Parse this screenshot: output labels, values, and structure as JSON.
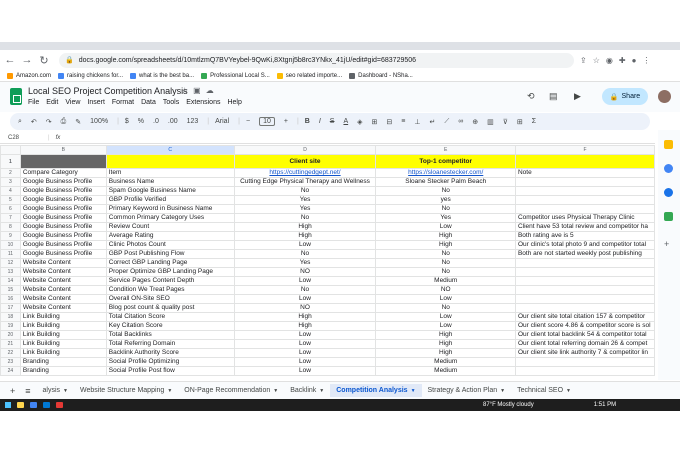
{
  "browser": {
    "url": "docs.google.com/spreadsheets/d/10mtlzmQ7BVYeybel-9QwKi,8Xtgnj5b8rc3YNkx_41jU/edit#gid=683729506",
    "bookmarks": [
      {
        "label": "Amazon.com",
        "color": "#ff9900"
      },
      {
        "label": "raising chickens for...",
        "color": "#4285f4"
      },
      {
        "label": "what is the best ba...",
        "color": "#4285f4"
      },
      {
        "label": "Professional Local S...",
        "color": "#34a853"
      },
      {
        "label": "seo related importe...",
        "color": "#fbbc04"
      },
      {
        "label": "Dashboard - NSha...",
        "color": "#5f6368"
      }
    ]
  },
  "sheets": {
    "title": "Local SEO Project  Competition Analysis",
    "menu": [
      "File",
      "Edit",
      "View",
      "Insert",
      "Format",
      "Data",
      "Tools",
      "Extensions",
      "Help"
    ],
    "share_label": "Share",
    "toolbar": {
      "zoom": "100%",
      "currency": "$",
      "percent": "%",
      "dec_less": ".0",
      "dec_more": ".00",
      "number_fmt": "123",
      "font": "Arial",
      "font_size": "10"
    },
    "cell_ref": "C28",
    "fx": "fx"
  },
  "grid": {
    "columns": [
      "B",
      "C",
      "D",
      "E",
      "F"
    ],
    "header_row": {
      "client": "Client site",
      "competitor": "Top-1 competitor"
    },
    "row2": {
      "a": "Compare Category",
      "b": "Item",
      "c": "https://cuttingedgept.net/",
      "d": "https://sloanestecker.com/",
      "e": "Note"
    },
    "rows": [
      [
        "3",
        "Google Business Profile",
        "Business Name",
        "Cutting Edge Physical Therapy and Wellness",
        "Sloane Stecker Palm Beach",
        ""
      ],
      [
        "4",
        "Google Business Profile",
        "Spam Google Business Name",
        "No",
        "No",
        ""
      ],
      [
        "5",
        "Google Business Profile",
        "GBP Profile Verified",
        "Yes",
        "yes",
        ""
      ],
      [
        "6",
        "Google Business Profile",
        "Primary Keyword in Business Name",
        "Yes",
        "No",
        ""
      ],
      [
        "7",
        "Google Business Profile",
        "Common Primary Category Uses",
        "No",
        "Yes",
        "Competitor uses Physical Therapy Clinic"
      ],
      [
        "8",
        "Google Business Profile",
        "Review Count",
        "High",
        "Low",
        "Client have 53 total review and competitor ha"
      ],
      [
        "9",
        "Google Business Profile",
        "Average Rating",
        "High",
        "High",
        "Both rating ave is 5"
      ],
      [
        "10",
        "Google Business Profile",
        "Clinic Photos Count",
        "Low",
        "High",
        "Our clinic's total photo 9 and competitor total"
      ],
      [
        "11",
        "Google Business Profile",
        "GBP Post Publishing Flow",
        "No",
        "No",
        "Both are not started weekly post publishing"
      ],
      [
        "12",
        "Website Content",
        "Correct GBP Landing Page",
        "Yes",
        "No",
        ""
      ],
      [
        "13",
        "Website Content",
        "Proper Optimize GBP Landing Page",
        "NO",
        "No",
        ""
      ],
      [
        "14",
        "Website Content",
        "Service Pages Content Depth",
        "Low",
        "Medium",
        ""
      ],
      [
        "15",
        "Website Content",
        "Condition We Treat Pages",
        "No",
        "NO",
        ""
      ],
      [
        "16",
        "Website Content",
        "Overall ON-Site SEO",
        "Low",
        "Low",
        ""
      ],
      [
        "17",
        "Website Content",
        "Blog post count & quality post",
        "NO",
        "No",
        ""
      ],
      [
        "18",
        "Link Building",
        "Total Citation Score",
        "High",
        "Low",
        "Our client site total citation 157 & competitor"
      ],
      [
        "19",
        "Link Building",
        "Key Citation Score",
        "High",
        "Low",
        "Our client score 4.86 & competitor score is sol"
      ],
      [
        "20",
        "Link Building",
        "Total Backlinks",
        "Low",
        "High",
        "Our client total backlink 54 & competitor total"
      ],
      [
        "21",
        "Link Building",
        "Total Referring Domain",
        "Low",
        "High",
        "Our client total referring domain 26 & compet"
      ],
      [
        "22",
        "Link Building",
        "Backlink Authority Score",
        "Low",
        "High",
        "Our client site link authority 7 & competitor lin"
      ],
      [
        "23",
        "Branding",
        "Social Profile Optimizing",
        "Low",
        "Medium",
        ""
      ],
      [
        "24",
        "Branding",
        "Social Profile Post flow",
        "Low",
        "Medium",
        ""
      ]
    ]
  },
  "tabs": [
    {
      "label": "alysis",
      "active": false
    },
    {
      "label": "Website Structure Mapping",
      "active": false
    },
    {
      "label": "ON-Page Recommendation",
      "active": false
    },
    {
      "label": "Backlink",
      "active": false
    },
    {
      "label": "Competition Analysis",
      "active": true
    },
    {
      "label": "Strategy & Action Plan",
      "active": false
    },
    {
      "label": "Technical SEO",
      "active": false
    }
  ],
  "taskbar": {
    "weather": "87°F  Mostly cloudy",
    "time": "1:51 PM"
  }
}
